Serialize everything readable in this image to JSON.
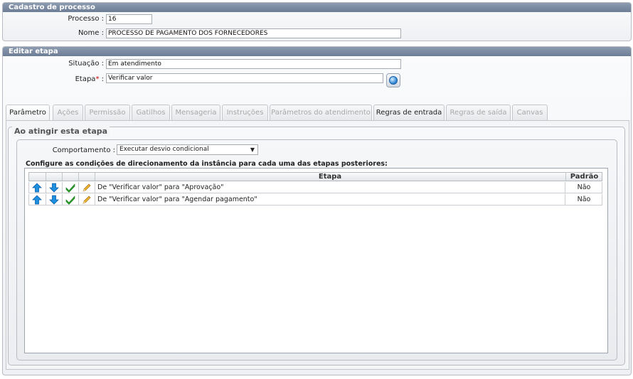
{
  "processo_panel": {
    "title": "Cadastro de processo",
    "processo_label": "Processo :",
    "processo_value": "16",
    "nome_label": "Nome :",
    "nome_value": "PROCESSO DE PAGAMENTO DOS FORNECEDORES"
  },
  "etapa_panel": {
    "title": "Editar etapa",
    "situacao_label": "Situação :",
    "situacao_value": "Em atendimento",
    "etapa_label": "Etapa",
    "etapa_required": "*",
    "etapa_colon": " :",
    "etapa_value": "Verificar valor",
    "lookup_icon": "globe-icon"
  },
  "tabs": [
    {
      "label": "Parâmetro",
      "state": "active"
    },
    {
      "label": "Ações",
      "state": "disabled"
    },
    {
      "label": "Permissão",
      "state": "disabled"
    },
    {
      "label": "Gatilhos",
      "state": "disabled"
    },
    {
      "label": "Mensageria",
      "state": "disabled"
    },
    {
      "label": "Instruções",
      "state": "disabled"
    },
    {
      "label": "Parâmetros do atendimento",
      "state": "disabled"
    },
    {
      "label": "Regras de entrada",
      "state": "enabled"
    },
    {
      "label": "Regras de saída",
      "state": "disabled"
    },
    {
      "label": "Canvas",
      "state": "disabled"
    }
  ],
  "parametro": {
    "legend": "Ao atingir esta etapa",
    "comportamento_label": "Comportamento :",
    "comportamento_value": "Executar desvio condicional",
    "config_text": "Configure as condições de direcionamento da instância para cada uma das etapas posteriores:",
    "grid": {
      "columns": [
        "Etapa",
        "Padrão"
      ],
      "rows": [
        {
          "etapa": "De \"Verificar valor\" para \"Aprovação\"",
          "padrao": "Não"
        },
        {
          "etapa": "De \"Verificar valor\" para \"Agendar pagamento\"",
          "padrao": "Não"
        }
      ],
      "row_icons": [
        "arrow-up-icon",
        "arrow-down-icon",
        "checkmark-icon",
        "pencil-icon"
      ]
    }
  },
  "colors": {
    "header_bg": "#7a889e",
    "arrow_blue": "#1e90e0",
    "check_green": "#2aa82a",
    "pencil_orange": "#e6a21e",
    "required_red": "#cc0000"
  }
}
